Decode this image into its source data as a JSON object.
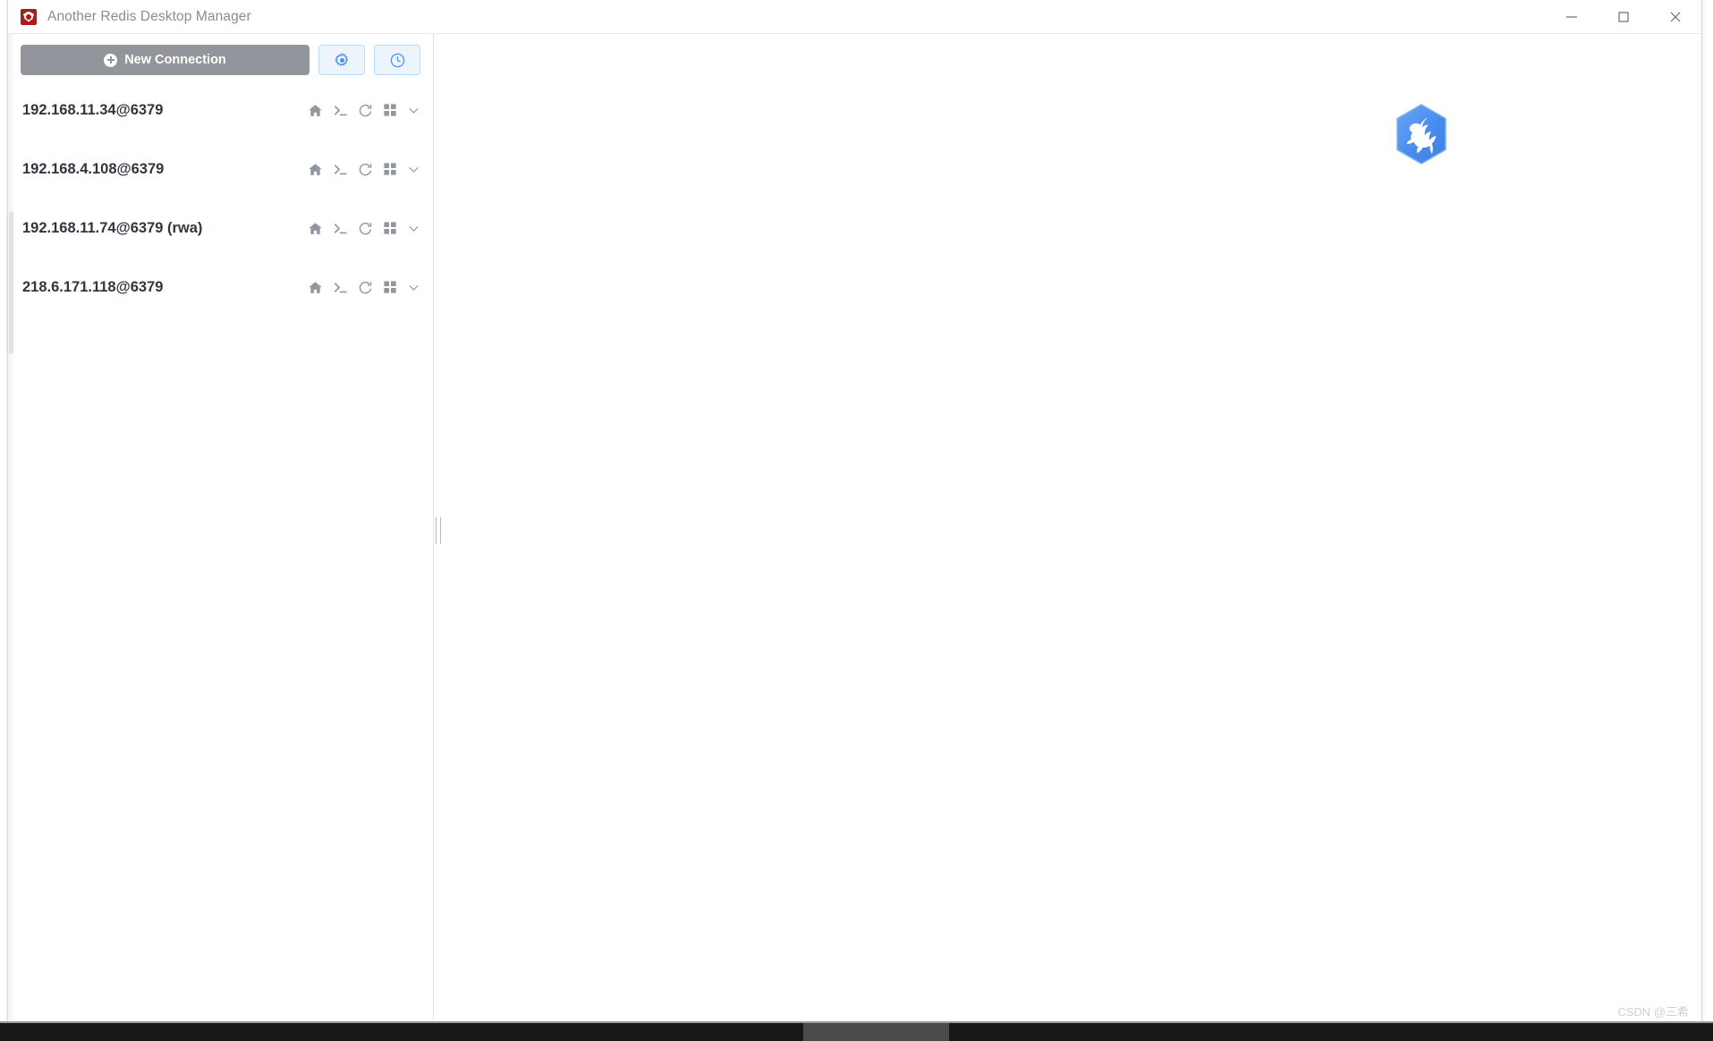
{
  "window": {
    "title": "Another Redis Desktop Manager",
    "app_icon": "redis-app-icon",
    "controls": {
      "minimize": "minimize-icon",
      "maximize": "maximize-icon",
      "close": "close-icon"
    }
  },
  "sidebar": {
    "toolbar": {
      "new_connection_label": "New Connection",
      "new_connection_icon": "plus-circle-icon",
      "settings_icon": "gear-icon",
      "history_icon": "clock-icon"
    },
    "connections": [
      {
        "name": "192.168.11.34@6379",
        "actions": [
          "home-icon",
          "terminal-icon",
          "refresh-icon",
          "grid-icon",
          "chevron-down-icon"
        ]
      },
      {
        "name": "192.168.4.108@6379",
        "actions": [
          "home-icon",
          "terminal-icon",
          "refresh-icon",
          "grid-icon",
          "chevron-down-icon"
        ]
      },
      {
        "name": "192.168.11.74@6379 (rwa)",
        "actions": [
          "home-icon",
          "terminal-icon",
          "refresh-icon",
          "grid-icon",
          "chevron-down-icon"
        ]
      },
      {
        "name": "218.6.171.118@6379",
        "actions": [
          "home-icon",
          "terminal-icon",
          "refresh-icon",
          "grid-icon",
          "chevron-down-icon"
        ]
      }
    ]
  },
  "main": {
    "logo": "ardm-bird-logo",
    "watermark": "CSDN @三希"
  },
  "colors": {
    "accent_blue": "#4a90f0",
    "button_gray": "#92969c",
    "icon_gray": "#9097a1",
    "title_gray": "#8c8c8c",
    "text_dark": "#30363d",
    "toolbar_btn_bg": "#ecf5fe",
    "toolbar_btn_border": "#b9dbfb",
    "app_icon_red": "#a81c1c"
  }
}
